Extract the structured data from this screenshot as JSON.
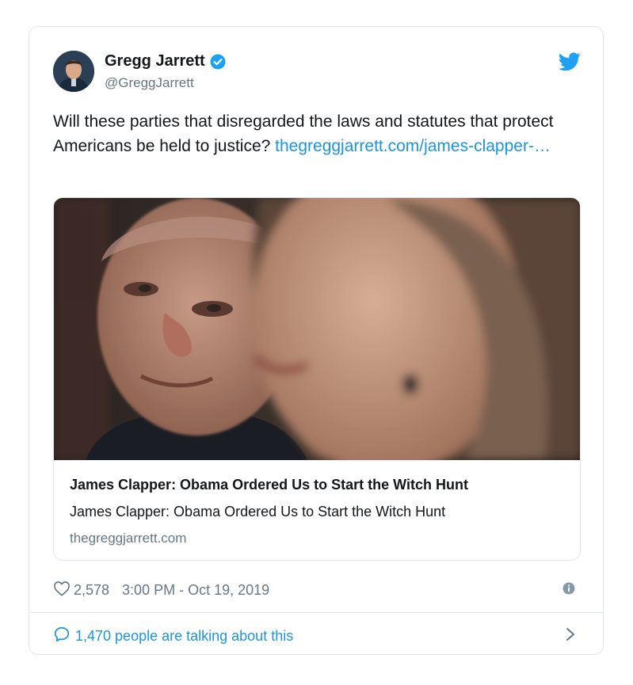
{
  "author": {
    "name": "Gregg Jarrett",
    "handle": "@GreggJarrett"
  },
  "tweet": {
    "text": "Will these parties that disregarded the laws and statutes that protect Americans be held to justice?",
    "link_text": "thegreggjarrett.com/james-clapper-…"
  },
  "link_card": {
    "title": "James Clapper: Obama Ordered Us to Start the Witch Hunt",
    "description": "James Clapper: Obama Ordered Us to Start the Witch Hunt",
    "domain": "thegreggjarrett.com"
  },
  "meta": {
    "likes": "2,578",
    "timestamp": "3:00 PM - Oct 19, 2019"
  },
  "footer": {
    "talking": "1,470 people are talking about this"
  },
  "colors": {
    "accent": "#1b95e0",
    "muted": "#657786",
    "border": "#e1e8ed",
    "like_icon": "#657786",
    "verified": "#1da1f2"
  },
  "icons": [
    "verified-badge-icon",
    "twitter-bird-icon",
    "heart-icon",
    "info-icon",
    "speech-bubble-icon",
    "chevron-right-icon"
  ]
}
